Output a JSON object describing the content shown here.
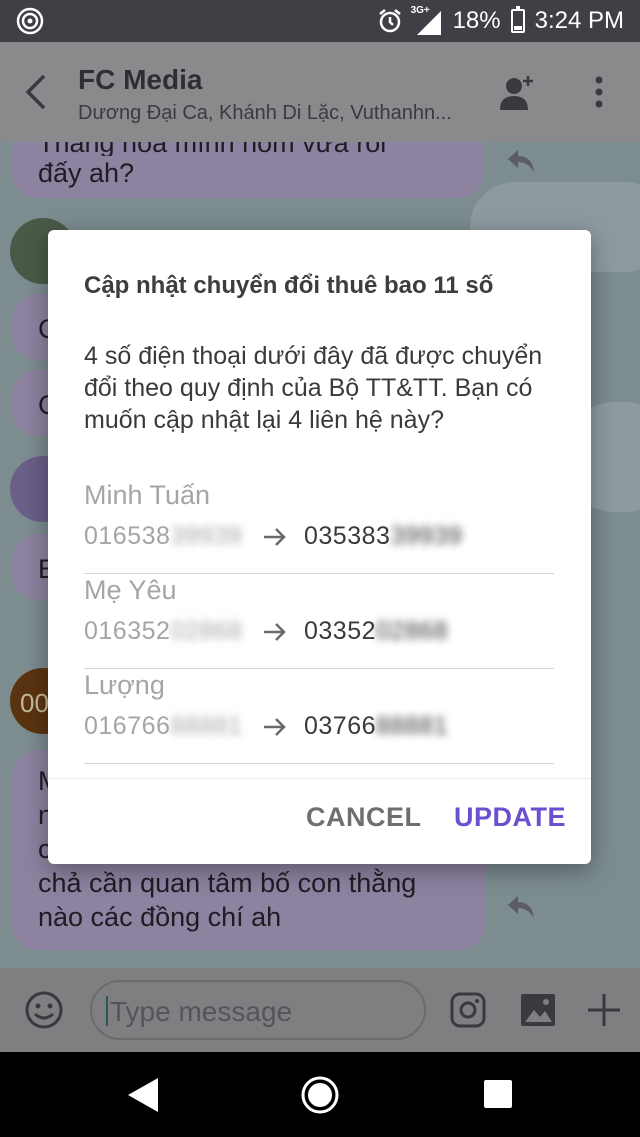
{
  "status_bar": {
    "network": "3G+",
    "battery": "18%",
    "time": "3:24 PM"
  },
  "header": {
    "title": "FC Media",
    "members": "Dương Đại Ca, Khánh Di Lặc, Vuthanhn..."
  },
  "chat": {
    "top_bubble_line1": "Thằng hoa mình nom vừa rồi",
    "top_bubble_line2": "đấy ah?",
    "avatar_partial": "00",
    "side_letters": [
      "C",
      "C",
      "E"
    ],
    "bottom_bubble_partial": [
      "M",
      "n",
      "c"
    ],
    "bottom_bubble_line1": "chả cần quan tâm bố con thằng",
    "bottom_bubble_line2": "nào các đồng chí ah"
  },
  "composer": {
    "placeholder": "Type message"
  },
  "dialog": {
    "title": "Cập nhật chuyển đổi thuê bao 11 số",
    "message": "4 số điện thoại dưới đây đã được chuyển đổi theo quy định của Bộ TT&TT. Bạn có muốn cập nhật lại 4 liên hệ này?",
    "contacts": [
      {
        "name": "Minh Tuấn",
        "old_prefix": "016538",
        "old_hidden": "39939",
        "new_prefix": "035383",
        "new_hidden": "39939"
      },
      {
        "name": "Mẹ Yêu",
        "old_prefix": "016352",
        "old_hidden": "02868",
        "new_prefix": "03352",
        "new_hidden": "02868"
      },
      {
        "name": "Lượng",
        "old_prefix": "016766",
        "old_hidden": "88881",
        "new_prefix": "03766",
        "new_hidden": "88881"
      }
    ],
    "cancel_label": "CANCEL",
    "update_label": "UPDATE"
  }
}
